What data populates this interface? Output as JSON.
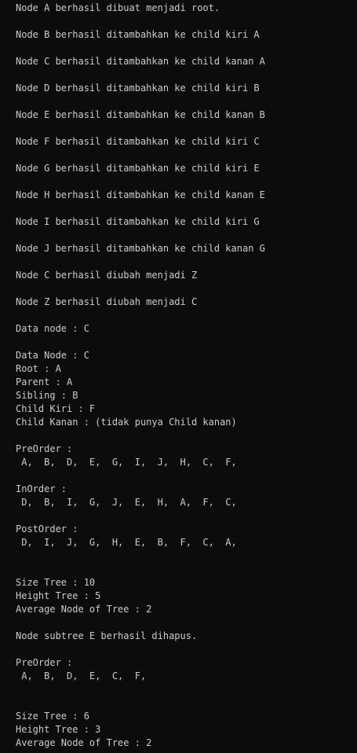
{
  "console": {
    "lines": [
      "Node A berhasil dibuat menjadi root.",
      "",
      "Node B berhasil ditambahkan ke child kiri A",
      "",
      "Node C berhasil ditambahkan ke child kanan A",
      "",
      "Node D berhasil ditambahkan ke child kiri B",
      "",
      "Node E berhasil ditambahkan ke child kanan B",
      "",
      "Node F berhasil ditambahkan ke child kiri C",
      "",
      "Node G berhasil ditambahkan ke child kiri E",
      "",
      "Node H berhasil ditambahkan ke child kanan E",
      "",
      "Node I berhasil ditambahkan ke child kiri G",
      "",
      "Node J berhasil ditambahkan ke child kanan G",
      "",
      "Node C berhasil diubah menjadi Z",
      "",
      "Node Z berhasil diubah menjadi C",
      "",
      "Data node : C",
      "",
      "Data Node : C",
      "Root : A",
      "Parent : A",
      "Sibling : B",
      "Child Kiri : F",
      "Child Kanan : (tidak punya Child kanan)",
      "",
      "PreOrder :",
      " A,  B,  D,  E,  G,  I,  J,  H,  C,  F,",
      "",
      "InOrder :",
      " D,  B,  I,  G,  J,  E,  H,  A,  F,  C,",
      "",
      "PostOrder :",
      " D,  I,  J,  G,  H,  E,  B,  F,  C,  A,",
      "",
      "",
      "Size Tree : 10",
      "Height Tree : 5",
      "Average Node of Tree : 2",
      "",
      "Node subtree E berhasil dihapus.",
      "",
      "PreOrder :",
      " A,  B,  D,  E,  C,  F,",
      "",
      "",
      "Size Tree : 6",
      "Height Tree : 3",
      "Average Node of Tree : 2"
    ]
  }
}
